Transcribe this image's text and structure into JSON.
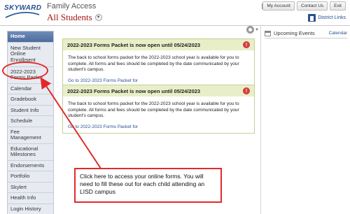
{
  "header": {
    "logo_text": "SKYWARD",
    "app_title": "Family Access",
    "student_selector": "All Students",
    "top_links": [
      "My Account",
      "Contact Us",
      "Exit"
    ],
    "district_links": "District Links"
  },
  "sidebar": {
    "items": [
      {
        "label": "Home"
      },
      {
        "label": "New Student Online Enrollment"
      },
      {
        "label": "2022-2023 Forms Packet"
      },
      {
        "label": "Calendar"
      },
      {
        "label": "Gradebook"
      },
      {
        "label": "Student Info"
      },
      {
        "label": "Schedule"
      },
      {
        "label": "Fee Management"
      },
      {
        "label": "Educational Milestones"
      },
      {
        "label": "Endorsements"
      },
      {
        "label": "Portfolio"
      },
      {
        "label": "Skylert"
      },
      {
        "label": "Health Info"
      },
      {
        "label": "Login History"
      }
    ]
  },
  "messages": [
    {
      "title": "2022-2023 Forms Packet is now open until 05/24/2023",
      "body": "The back to school forms packet for the 2022-2023 school year is available for you to complete. All forms and fees should be completed by the date communicated by your student's campus.",
      "link": "Go to 2022-2023 Forms Packet for"
    },
    {
      "title": "2022-2023 Forms Packet is now open until 05/24/2023",
      "body": "The back to school forms packet for the 2022-2023 school year is available for you to complete. All forms and fees should be completed by the date communicated by your student's campus.",
      "link": "Go to 2022-2023 Forms Packet for"
    }
  ],
  "right_panel": {
    "title": "Upcoming Events",
    "calendar_link": "Calendar"
  },
  "annotation": {
    "text": "Click here to access your online forms. You will need to fill these out for each child attending an LISD campus",
    "color": "#e22a2a"
  },
  "colors": {
    "brand": "#27508f",
    "student_name": "#a31515",
    "nav_active": "#5a79aa",
    "message_header": "#e8efc8"
  }
}
